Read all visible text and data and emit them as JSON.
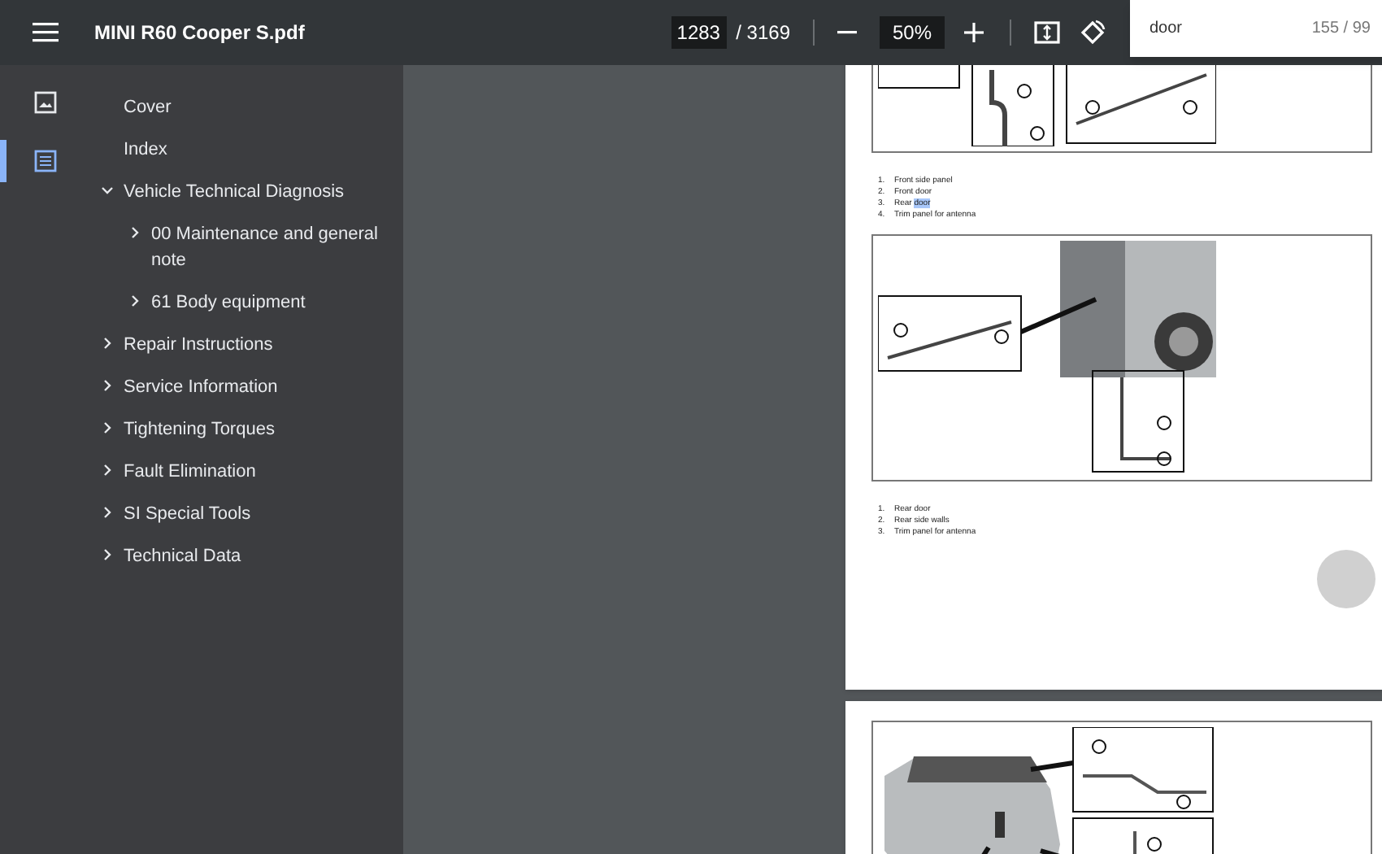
{
  "toolbar": {
    "title": "MINI R60 Cooper S.pdf",
    "page_current": "1283",
    "page_total": "/ 3169",
    "zoom": "50%"
  },
  "search": {
    "value": "door",
    "count": "155 / 99"
  },
  "rail": [
    {
      "kind": "thumbnails",
      "selected": false
    },
    {
      "kind": "outline",
      "selected": true
    }
  ],
  "outline": [
    {
      "label": "Cover"
    },
    {
      "label": "Index"
    },
    {
      "label": "Vehicle Technical Diagnosis",
      "expanded": true,
      "children": [
        {
          "label": "00 Maintenance and general note",
          "expanded": false
        },
        {
          "label": "61 Body equipment",
          "expanded": false
        }
      ]
    },
    {
      "label": "Repair Instructions",
      "expanded": false
    },
    {
      "label": "Service Information",
      "expanded": false
    },
    {
      "label": "Tightening Torques",
      "expanded": false
    },
    {
      "label": "Fault Elimination",
      "expanded": false
    },
    {
      "label": "SI Special Tools",
      "expanded": false
    },
    {
      "label": "Technical Data",
      "expanded": false
    }
  ],
  "pages": [
    {
      "blocks": [
        {
          "kind": "figure-top"
        },
        {
          "kind": "legend",
          "items": [
            {
              "number": "1.",
              "text": "Front side panel"
            },
            {
              "number": "2.",
              "text": "Front door"
            },
            {
              "number": "3.",
              "text": "Rear ",
              "match": "door"
            },
            {
              "number": "4.",
              "text": "Trim panel for antenna"
            }
          ]
        },
        {
          "kind": "figure-door"
        },
        {
          "kind": "legend",
          "items": [
            {
              "number": "1.",
              "text": "Rear door"
            },
            {
              "number": "2.",
              "text": "Rear side walls"
            },
            {
              "number": "3.",
              "text": "Trim panel for antenna"
            }
          ]
        }
      ]
    },
    {
      "blocks": [
        {
          "kind": "figure-car"
        }
      ]
    }
  ]
}
